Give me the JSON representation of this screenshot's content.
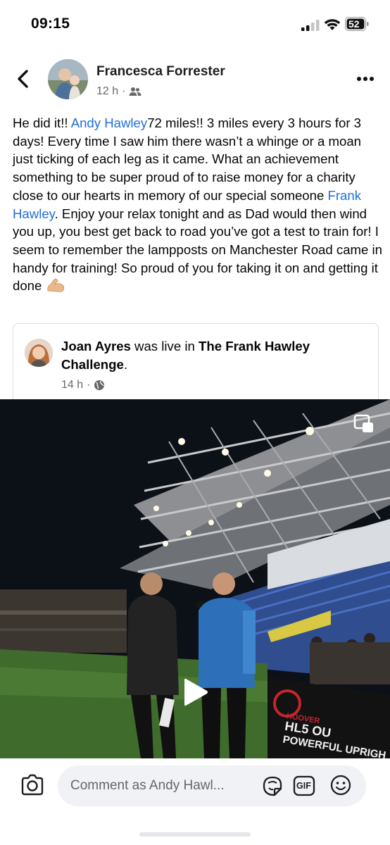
{
  "status_bar": {
    "time": "09:15",
    "battery_level": "52",
    "icons": [
      "cellular-signal-icon",
      "wifi-icon",
      "battery-icon"
    ]
  },
  "post": {
    "author": "Francesca Forrester",
    "timestamp": "12 h",
    "separator": "·",
    "audience_icon": "friends-icon",
    "text": {
      "p1": "He did it!! ",
      "mention1": "Andy Hawley",
      "p2": "72 miles!! 3 miles every 3 hours for 3 days! Every time I saw him there wasn’t a whinge or a moan just ticking of each leg as it came. What an achievement something to be super proud of to raise money for a charity close to our hearts in memory of our special someone ",
      "mention2": "Frank Hawley",
      "p3": ". Enjoy your relax tonight and as Dad would then wind you up, you best get back to road you’ve got a test to train for! I seem to remember the lampposts on Manchester Road came in handy for training! So proud of you for taking it on and getting it done "
    }
  },
  "shared": {
    "name": "Joan Ayres",
    "action": " was live in ",
    "group": "The Frank Hawley Challenge",
    "period": ".",
    "timestamp": "14 h",
    "separator": "·",
    "audience_icon": "globe-icon"
  },
  "video": {
    "banner_text_1": "HL5 OU",
    "banner_text_2": "POWERFUL UPRIGH",
    "banner_text_3": "HOOVER",
    "icons": [
      "picture-in-picture-icon",
      "play-icon"
    ]
  },
  "comment_bar": {
    "placeholder": "Comment as Andy Hawl...",
    "gif_label": "GIF",
    "icons": [
      "camera-icon",
      "avatar-sticker-icon",
      "gif-icon",
      "emoji-icon"
    ]
  },
  "colors": {
    "mention": "#216fdb",
    "secondary_text": "#65676b",
    "input_bg": "#f0f2f5"
  }
}
